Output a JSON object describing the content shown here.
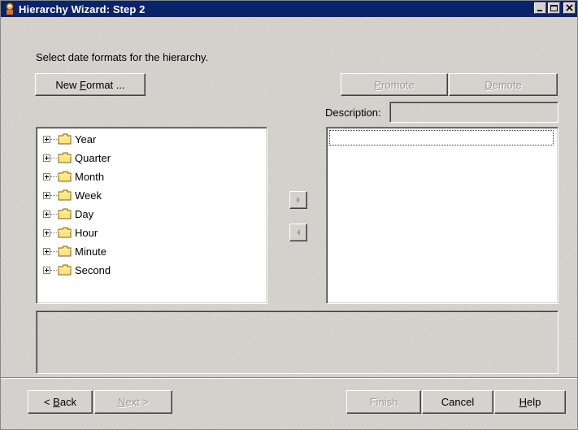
{
  "window": {
    "title": "Hierarchy Wizard: Step 2",
    "controls": [
      "minimize",
      "maximize",
      "close"
    ]
  },
  "instruction": "Select date formats for the hierarchy.",
  "buttons": {
    "new_format": {
      "pre": "New ",
      "mn": "F",
      "post": "ormat ..."
    },
    "promote": {
      "pre": "",
      "mn": "P",
      "post": "romote"
    },
    "demote": {
      "pre": "",
      "mn": "D",
      "post": "emote"
    },
    "back": {
      "pre": "< ",
      "mn": "B",
      "post": "ack"
    },
    "next": {
      "pre": "",
      "mn": "N",
      "post": "ext >"
    },
    "finish": "Finish",
    "cancel": "Cancel",
    "help": {
      "pre": "",
      "mn": "H",
      "post": "elp"
    }
  },
  "description_label": "Description:",
  "description_value": "",
  "tree_items": [
    "Year",
    "Quarter",
    "Month",
    "Week",
    "Day",
    "Hour",
    "Minute",
    "Second"
  ],
  "selected_items": [],
  "colors": {
    "titlebar": "#0a246a",
    "face": "#d6d3ce",
    "folder": "#ffe680"
  },
  "icons": {
    "add": "triangle-right-icon",
    "remove": "triangle-left-icon",
    "folder": "folder-icon",
    "expand": "plus-box-icon"
  }
}
